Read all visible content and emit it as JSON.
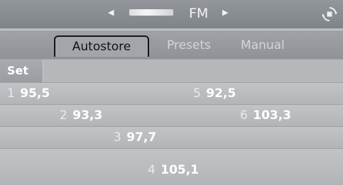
{
  "header": {
    "band": "FM",
    "prev_icon": "triangle-left-icon",
    "next_icon": "triangle-right-icon",
    "graphic_icon": "band-bar-icon",
    "corner_icon": "rotate-dial-icon"
  },
  "tabs": [
    {
      "label": "Autostore",
      "active": true
    },
    {
      "label": "Presets",
      "active": false
    },
    {
      "label": "Manual",
      "active": false
    }
  ],
  "set_label": "Set",
  "presets": [
    {
      "num": "1",
      "freq": "95,5"
    },
    {
      "num": "5",
      "freq": "92,5"
    },
    {
      "num": "2",
      "freq": "93,3"
    },
    {
      "num": "6",
      "freq": "103,3"
    },
    {
      "num": "3",
      "freq": "97,7"
    },
    {
      "num": "4",
      "freq": "105,1"
    }
  ]
}
